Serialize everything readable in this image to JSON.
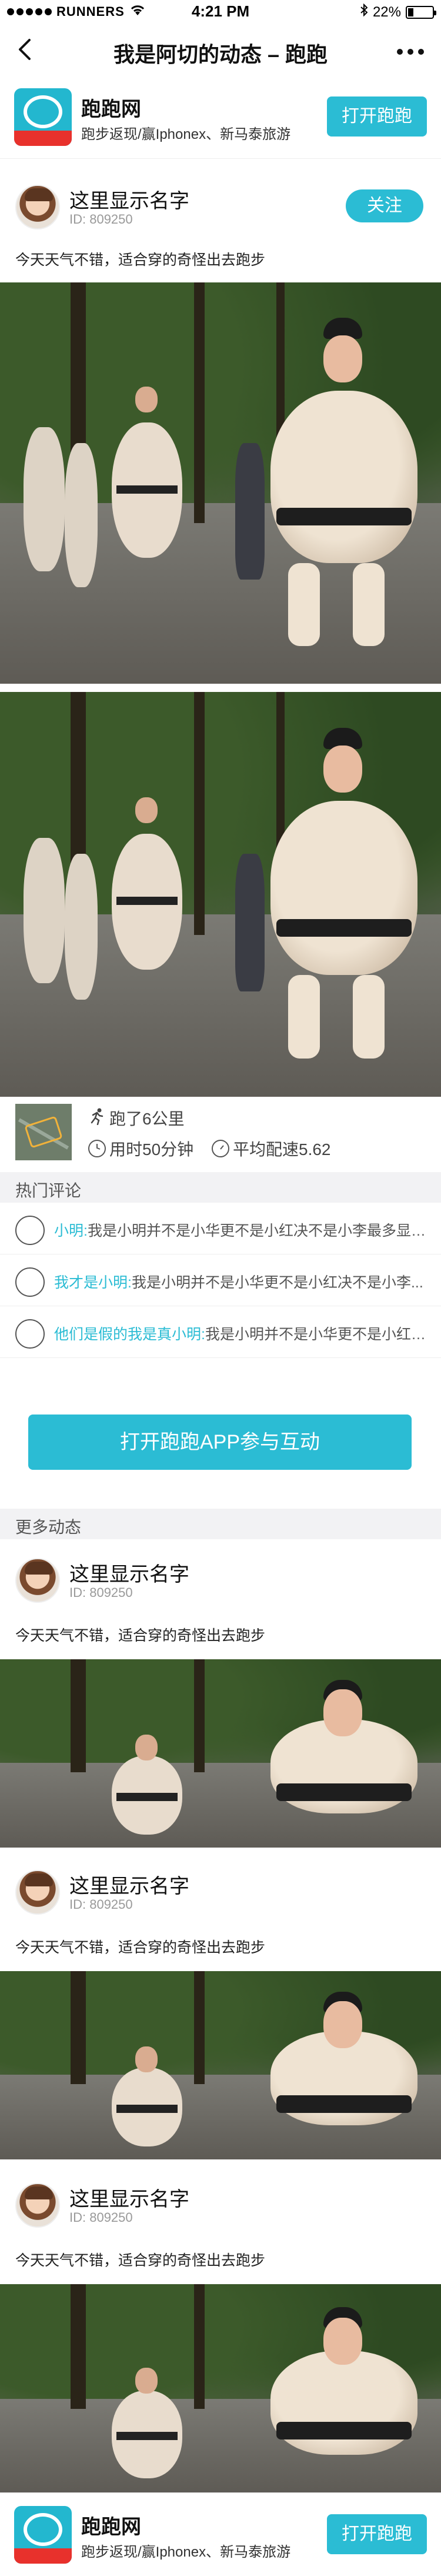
{
  "status_bar": {
    "carrier": "RUNNERS",
    "time": "4:21 PM",
    "battery": "22%",
    "battery_level": 0.22,
    "icons": [
      "signal-dots",
      "wifi-icon",
      "bluetooth-icon",
      "battery-icon"
    ]
  },
  "nav": {
    "back_icon": "chevron-left-icon",
    "title": "我是阿切的动态 – 跑跑",
    "more_icon": "ellipsis-icon"
  },
  "app_banner": {
    "name": "跑跑网",
    "desc": "跑步返现/赢Iphonex、新马泰旅游",
    "open_label": "打开跑跑",
    "logo_text": "运动时"
  },
  "post": {
    "user_name": "这里显示名字",
    "user_id": "ID: 809250",
    "follow_label": "关注",
    "text": "今天天气不错，适合穿的奇怪出去跑步"
  },
  "run_stats": {
    "distance": "跑了6公里",
    "duration": "用时50分钟",
    "pace": "平均配速5.62"
  },
  "hot_comments": {
    "title": "热门评论",
    "items": [
      {
        "user": "小明:",
        "text": "我是小明并不是小华更不是小红决不是小李最多显示..."
      },
      {
        "user": "我才是小明:",
        "text": "我是小明并不是小华更不是小红决不是小李..."
      },
      {
        "user": "他们是假的我是真小明:",
        "text": "我是小明并不是小华更不是小红决不是小李..."
      }
    ]
  },
  "cta": {
    "label": "打开跑跑APP参与互动"
  },
  "more_posts": {
    "title": "更多动态",
    "items": [
      {
        "user_name": "这里显示名字",
        "user_id": "ID: 809250",
        "text": "今天天气不错，适合穿的奇怪出去跑步"
      },
      {
        "user_name": "这里显示名字",
        "user_id": "ID: 809250",
        "text": "今天天气不错，适合穿的奇怪出去跑步"
      },
      {
        "user_name": "这里显示名字",
        "user_id": "ID: 809250",
        "text": "今天天气不错，适合穿的奇怪出去跑步"
      }
    ]
  },
  "colors": {
    "accent": "#2bbcd4",
    "section_bg": "#f2f2f4",
    "logo_red": "#e8312c"
  }
}
